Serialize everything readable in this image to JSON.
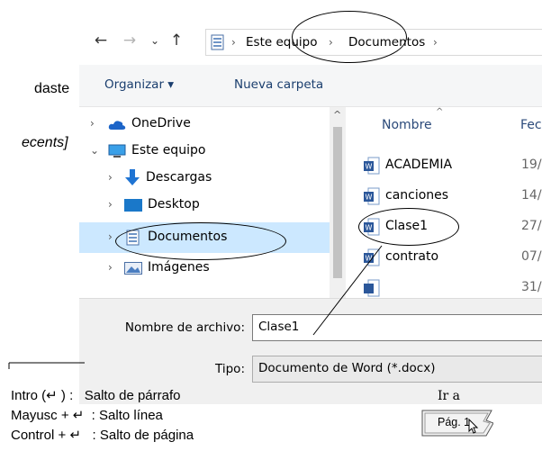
{
  "left_fragments": {
    "line1": "daste",
    "line2": "ecents]"
  },
  "address_bar": {
    "back": "←",
    "forward": "→",
    "recent": "⌄",
    "up": "↑",
    "crumbs": [
      "Este equipo",
      "Documentos"
    ],
    "sep": "›"
  },
  "toolbar": {
    "organize": "Organizar ▾",
    "new_folder": "Nueva carpeta"
  },
  "nav": {
    "items": [
      {
        "label": "OneDrive",
        "chev": "›"
      },
      {
        "label": "Este equipo",
        "chev": "⌄"
      },
      {
        "label": "Descargas",
        "chev": "›"
      },
      {
        "label": "Desktop",
        "chev": "›"
      },
      {
        "label": "Documentos",
        "chev": "›"
      },
      {
        "label": "Imágenes",
        "chev": "›"
      }
    ],
    "scroll_up": "^"
  },
  "files": {
    "headers": {
      "name": "Nombre",
      "date": "Fec"
    },
    "rows": [
      {
        "name": "ACADEMIA",
        "date": "19/"
      },
      {
        "name": "canciones",
        "date": "14/"
      },
      {
        "name": "Clase1",
        "date": "27/"
      },
      {
        "name": "contrato",
        "date": "07/"
      },
      {
        "name": "",
        "date": "31/"
      }
    ]
  },
  "bottom": {
    "filename_label": "Nombre de archivo:",
    "filename_value": "Clase1",
    "type_label": "Tipo:",
    "type_value": "Documento de Word (*.docx)"
  },
  "shortcuts": {
    "line1": "Intro (↵ ) :   Salto de párrafo",
    "line2": "Mayusc + ↵  : Salto línea",
    "line3": "Control + ↵   : Salto de página"
  },
  "goto": {
    "label": "Ir a",
    "button": "Pág.  1"
  },
  "colors": {
    "selection": "#cce8ff",
    "toolbar_bg": "#f5f6f7",
    "bottom_bg": "#f0f0f0",
    "link": "#1a3e6e"
  }
}
